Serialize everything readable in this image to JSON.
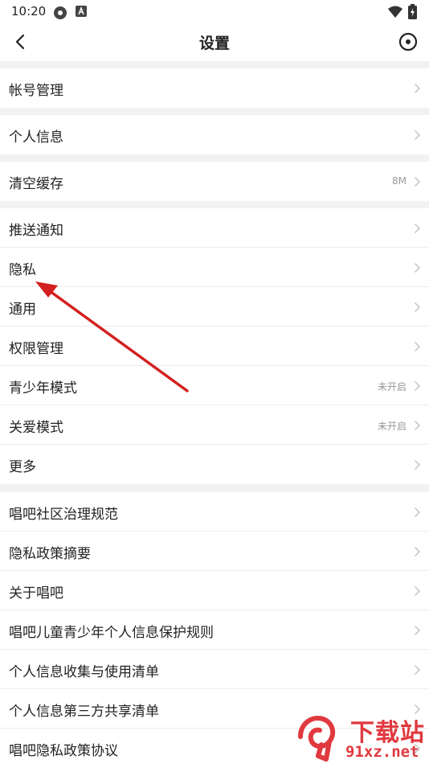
{
  "status": {
    "time": "10:20"
  },
  "header": {
    "title": "设置"
  },
  "groups": [
    {
      "items": [
        {
          "label": "帐号管理",
          "value": ""
        }
      ]
    },
    {
      "items": [
        {
          "label": "个人信息",
          "value": ""
        }
      ]
    },
    {
      "items": [
        {
          "label": "清空缓存",
          "value": "8M"
        }
      ]
    },
    {
      "items": [
        {
          "label": "推送通知",
          "value": ""
        },
        {
          "label": "隐私",
          "value": ""
        },
        {
          "label": "通用",
          "value": ""
        },
        {
          "label": "权限管理",
          "value": ""
        },
        {
          "label": "青少年模式",
          "value": "未开启"
        },
        {
          "label": "关爱模式",
          "value": "未开启"
        },
        {
          "label": "更多",
          "value": ""
        }
      ]
    },
    {
      "items": [
        {
          "label": "唱吧社区治理规范",
          "value": ""
        },
        {
          "label": "隐私政策摘要",
          "value": ""
        },
        {
          "label": "关于唱吧",
          "value": ""
        },
        {
          "label": "唱吧儿童青少年个人信息保护规则",
          "value": ""
        },
        {
          "label": "个人信息收集与使用清单",
          "value": ""
        },
        {
          "label": "个人信息第三方共享清单",
          "value": ""
        },
        {
          "label": "唱吧隐私政策协议",
          "value": ""
        }
      ]
    }
  ],
  "watermark": {
    "brand": "下载站",
    "domain": "91xz.net"
  },
  "colors": {
    "annotation_arrow": "#d42020",
    "watermark": "#e0393e"
  },
  "icons": [
    "back-arrow-icon",
    "target-icon",
    "chevron-right-icon",
    "wifi-icon",
    "battery-icon"
  ]
}
